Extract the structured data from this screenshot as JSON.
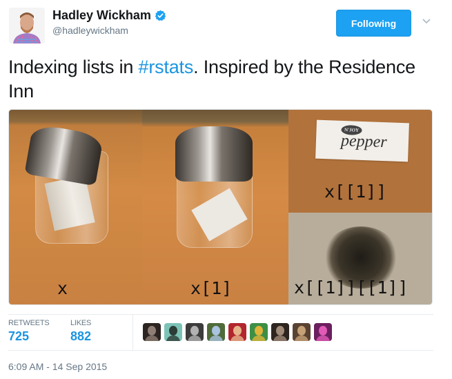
{
  "author": {
    "name": "Hadley Wickham",
    "handle": "@hadleywickham",
    "verified": true,
    "avatar_icon": "avatar-photo"
  },
  "follow_button": {
    "label": "Following"
  },
  "menu_icon": "chevron-down-icon",
  "tweet": {
    "text_before": "Indexing lists in ",
    "hashtag": "#rstats",
    "text_after": ". Inspired by the Residence Inn"
  },
  "media": {
    "panels": [
      {
        "label": "x",
        "depicts": "pepper shaker with multiple pepper packets"
      },
      {
        "label": "x[1]",
        "depicts": "pepper shaker with one pepper packet"
      },
      {
        "label": "x[[1]]",
        "depicts": "single pepper packet",
        "packet_brand": "N'JOY",
        "packet_text": "pepper"
      },
      {
        "label": "x[[1]][[1]]",
        "depicts": "pile of ground pepper"
      }
    ]
  },
  "stats": {
    "retweets": {
      "label": "RETWEETS",
      "value": "725"
    },
    "likes": {
      "label": "LIKES",
      "value": "882"
    }
  },
  "likers": [
    {
      "color_a": "#2b2421",
      "color_b": "#8e7e74"
    },
    {
      "color_a": "#7cc3b6",
      "color_b": "#2c3c36"
    },
    {
      "color_a": "#3c3c3c",
      "color_b": "#b2b2b2"
    },
    {
      "color_a": "#4f6b3a",
      "color_b": "#a9c4e0"
    },
    {
      "color_a": "#b2262e",
      "color_b": "#e6b48c"
    },
    {
      "color_a": "#3d8f46",
      "color_b": "#e0b43a"
    },
    {
      "color_a": "#2e2520",
      "color_b": "#a08a78"
    },
    {
      "color_a": "#5a4232",
      "color_b": "#c5a176"
    },
    {
      "color_a": "#6b1f5e",
      "color_b": "#e05ab6"
    }
  ],
  "timestamp": "6:09 AM - 14 Sep 2015",
  "colors": {
    "accent": "#1da1f2",
    "link": "#1b95e0",
    "secondary_text": "#657786",
    "divider": "#e6ecf0"
  }
}
